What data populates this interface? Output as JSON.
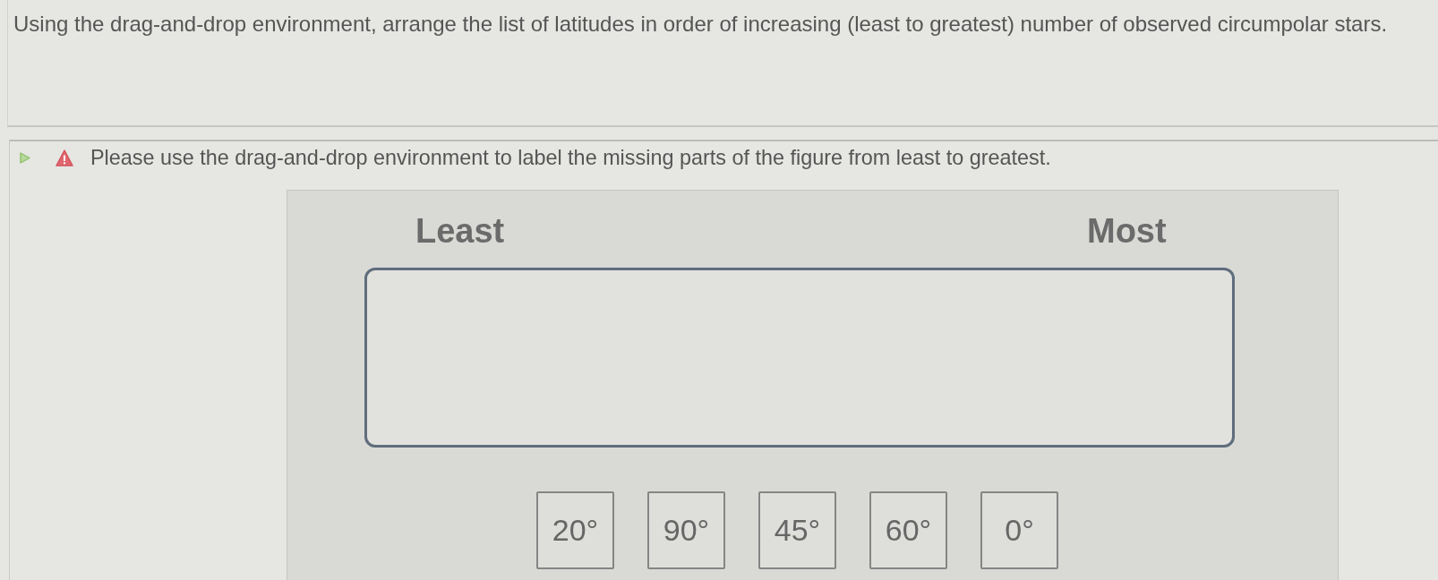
{
  "question": {
    "text": "Using the drag-and-drop environment, arrange the list of latitudes in order of increasing (least to greatest) number of observed circumpolar stars."
  },
  "feedback": {
    "kind": "warning",
    "text": "Please use the drag-and-drop environment to label the missing parts of the figure from least to greatest."
  },
  "figure": {
    "start_label": "Least",
    "end_label": "Most"
  },
  "tiles": [
    {
      "label": "20°"
    },
    {
      "label": "90°"
    },
    {
      "label": "45°"
    },
    {
      "label": "60°"
    },
    {
      "label": "0°"
    }
  ]
}
